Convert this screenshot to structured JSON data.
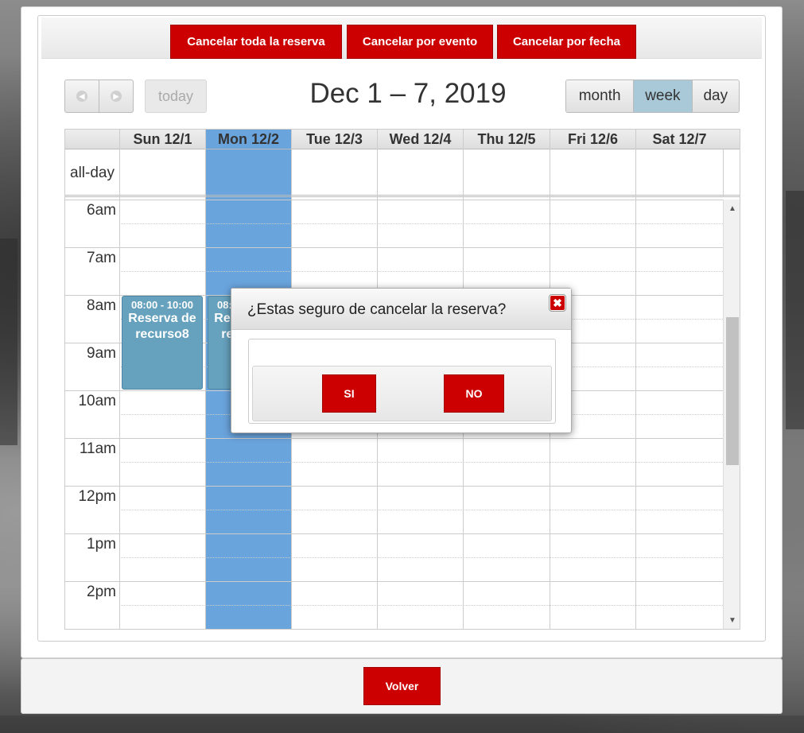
{
  "toolbar": {
    "cancel_all_label": "Cancelar toda la reserva",
    "cancel_event_label": "Cancelar por evento",
    "cancel_date_label": "Cancelar por fecha"
  },
  "calendar": {
    "title": "Dec 1 – 7, 2019",
    "today_label": "today",
    "views": {
      "month": "month",
      "week": "week",
      "day": "day",
      "active": "week"
    },
    "days": [
      "Sun 12/1",
      "Mon 12/2",
      "Tue 12/3",
      "Wed 12/4",
      "Thu 12/5",
      "Fri 12/6",
      "Sat 12/7"
    ],
    "highlighted_day": "Mon 12/2",
    "allday_label": "all-day",
    "hours": [
      "6am",
      "7am",
      "8am",
      "9am",
      "10am",
      "11am",
      "12pm",
      "1pm",
      "2pm"
    ],
    "events": [
      {
        "day": "Sun 12/1",
        "time": "08:00 - 10:00",
        "title": "Reserva de recurso8"
      },
      {
        "day": "Mon 12/2",
        "time": "08:00 - 10:00",
        "title": "Reserva de recurso8"
      }
    ]
  },
  "dialog": {
    "title": "¿Estas seguro de cancelar la reserva?",
    "close_icon": "close-icon",
    "yes_label": "SI",
    "no_label": "NO"
  },
  "footer": {
    "back_label": "Volver"
  },
  "colors": {
    "accent_red": "#cc0000",
    "highlight_day": "#6aa4dd",
    "event_bg": "#66a1bd",
    "active_view": "#a9c8d8"
  }
}
